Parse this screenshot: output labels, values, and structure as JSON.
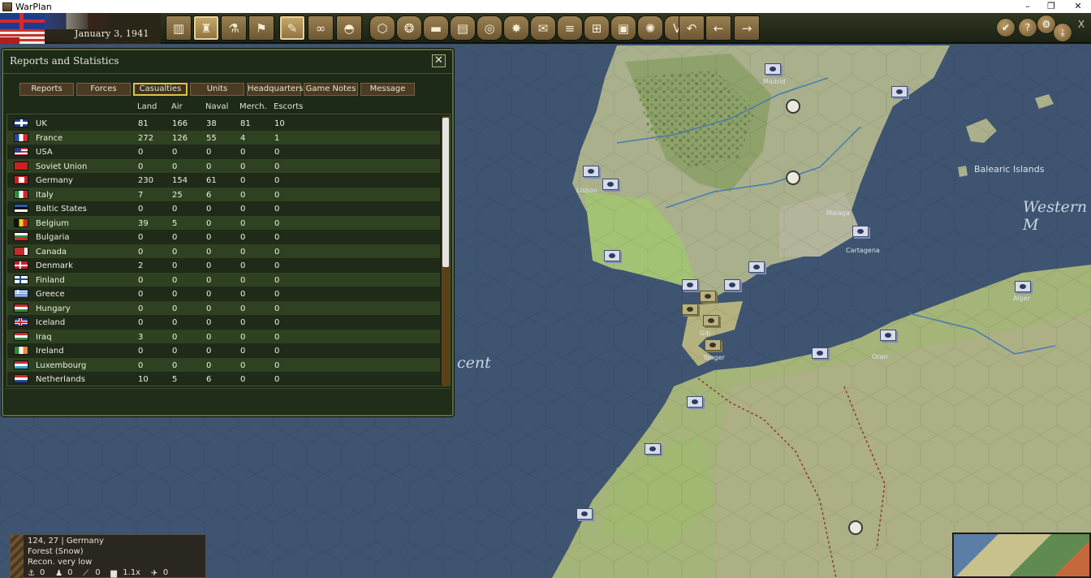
{
  "window": {
    "title": "WarPlan",
    "minimize": "–",
    "maximize": "❐",
    "close": "✕"
  },
  "toolbar": {
    "date": "January 3, 1941",
    "buttons": [
      {
        "name": "production-icon",
        "glyph": "▥"
      },
      {
        "name": "units-icon",
        "glyph": "♜"
      },
      {
        "name": "research-icon",
        "glyph": "⚗"
      },
      {
        "name": "diplomacy-flag-icon",
        "glyph": "⚑"
      },
      {
        "name": "reports-icon",
        "glyph": "✎"
      },
      {
        "name": "binoculars-icon",
        "glyph": "∞"
      },
      {
        "name": "helmet-icon",
        "glyph": "◓"
      },
      {
        "name": "map-filter-icon",
        "glyph": "⬡"
      },
      {
        "name": "hex-group-icon",
        "glyph": "❂"
      },
      {
        "name": "armor-icon",
        "glyph": "▬"
      },
      {
        "name": "supply-icon",
        "glyph": "▤"
      },
      {
        "name": "target-icon",
        "glyph": "◎"
      },
      {
        "name": "explosion-icon",
        "glyph": "✸"
      },
      {
        "name": "mail-icon",
        "glyph": "✉"
      },
      {
        "name": "rail-icon",
        "glyph": "≡"
      },
      {
        "name": "grid-icon",
        "glyph": "⊞"
      },
      {
        "name": "frame-icon",
        "glyph": "▣"
      },
      {
        "name": "fire-icon",
        "glyph": "✺"
      },
      {
        "name": "victory-icon",
        "glyph": "V"
      },
      {
        "name": "undo-icon",
        "glyph": "↶"
      },
      {
        "name": "prev-arrow-icon",
        "glyph": "←"
      },
      {
        "name": "next-arrow-icon",
        "glyph": "→"
      }
    ],
    "right_buttons": [
      {
        "name": "confirm-icon",
        "glyph": "✔"
      },
      {
        "name": "help-icon",
        "glyph": "?"
      },
      {
        "name": "settings-icon",
        "glyph": "⚙"
      },
      {
        "name": "save-icon",
        "glyph": "⤓"
      },
      {
        "name": "exit-icon",
        "glyph": "X"
      }
    ]
  },
  "map": {
    "labels": {
      "sea_west": "Western M",
      "sea_cent": "cent",
      "balearic": "Balearic Islands",
      "madrid": "Madrid",
      "lisbon": "Lisbon",
      "gibraltar": "Gib",
      "tangier": "Tanger",
      "algiers": "Alger",
      "oran": "Oran",
      "cartagena": "Cartagena",
      "malaga": "Malaga"
    },
    "colors": {
      "sea": "#3e5470",
      "land_plain": "#a7b77a",
      "land_hills": "#aab28c",
      "land_green": "#9fbc70",
      "allied_unit": "#d7dce8",
      "axis_unit": "#b8b185"
    }
  },
  "reports": {
    "title": "Reports and Statistics",
    "close": "✕",
    "tabs": [
      "Reports",
      "Forces",
      "Casualties",
      "Units",
      "Headquarters",
      "Game Notes",
      "Message"
    ],
    "active_tab": "Casualties",
    "columns": [
      "Land",
      "Air",
      "Naval",
      "Merch.",
      "Escorts"
    ],
    "rows": [
      {
        "flag": "uk",
        "country": "UK",
        "land": "81",
        "air": "166",
        "naval": "38",
        "merch": "81",
        "escorts": "10"
      },
      {
        "flag": "fr",
        "country": "France",
        "land": "272",
        "air": "126",
        "naval": "55",
        "merch": "4",
        "escorts": "1"
      },
      {
        "flag": "us",
        "country": "USA",
        "land": "0",
        "air": "0",
        "naval": "0",
        "merch": "0",
        "escorts": "0"
      },
      {
        "flag": "su",
        "country": "Soviet Union",
        "land": "0",
        "air": "0",
        "naval": "0",
        "merch": "0",
        "escorts": "0"
      },
      {
        "flag": "de",
        "country": "Germany",
        "land": "230",
        "air": "154",
        "naval": "61",
        "merch": "0",
        "escorts": "0"
      },
      {
        "flag": "it",
        "country": "Italy",
        "land": "7",
        "air": "25",
        "naval": "6",
        "merch": "0",
        "escorts": "0"
      },
      {
        "flag": "bs",
        "country": "Baltic States",
        "land": "0",
        "air": "0",
        "naval": "0",
        "merch": "0",
        "escorts": "0"
      },
      {
        "flag": "be",
        "country": "Belgium",
        "land": "39",
        "air": "5",
        "naval": "0",
        "merch": "0",
        "escorts": "0"
      },
      {
        "flag": "bg",
        "country": "Bulgaria",
        "land": "0",
        "air": "0",
        "naval": "0",
        "merch": "0",
        "escorts": "0"
      },
      {
        "flag": "ca",
        "country": "Canada",
        "land": "0",
        "air": "0",
        "naval": "0",
        "merch": "0",
        "escorts": "0"
      },
      {
        "flag": "dk",
        "country": "Denmark",
        "land": "2",
        "air": "0",
        "naval": "0",
        "merch": "0",
        "escorts": "0"
      },
      {
        "flag": "fi",
        "country": "Finland",
        "land": "0",
        "air": "0",
        "naval": "0",
        "merch": "0",
        "escorts": "0"
      },
      {
        "flag": "gr",
        "country": "Greece",
        "land": "0",
        "air": "0",
        "naval": "0",
        "merch": "0",
        "escorts": "0"
      },
      {
        "flag": "hu",
        "country": "Hungary",
        "land": "0",
        "air": "0",
        "naval": "0",
        "merch": "0",
        "escorts": "0"
      },
      {
        "flag": "is",
        "country": "Iceland",
        "land": "0",
        "air": "0",
        "naval": "0",
        "merch": "0",
        "escorts": "0"
      },
      {
        "flag": "iq",
        "country": "Iraq",
        "land": "3",
        "air": "0",
        "naval": "0",
        "merch": "0",
        "escorts": "0"
      },
      {
        "flag": "ie",
        "country": "Ireland",
        "land": "0",
        "air": "0",
        "naval": "0",
        "merch": "0",
        "escorts": "0"
      },
      {
        "flag": "lu",
        "country": "Luxembourg",
        "land": "0",
        "air": "0",
        "naval": "0",
        "merch": "0",
        "escorts": "0"
      },
      {
        "flag": "nl",
        "country": "Netherlands",
        "land": "10",
        "air": "5",
        "naval": "6",
        "merch": "0",
        "escorts": "0"
      }
    ],
    "scroll_fraction_visible": 0.56
  },
  "hexinfo": {
    "coords": "124, 27",
    "sep": "|",
    "owner": "Germany",
    "terrain": "Forest (Snow)",
    "recon": "Recon. very low",
    "stats": [
      "0",
      "0",
      "0",
      "1.1x",
      "0"
    ]
  }
}
